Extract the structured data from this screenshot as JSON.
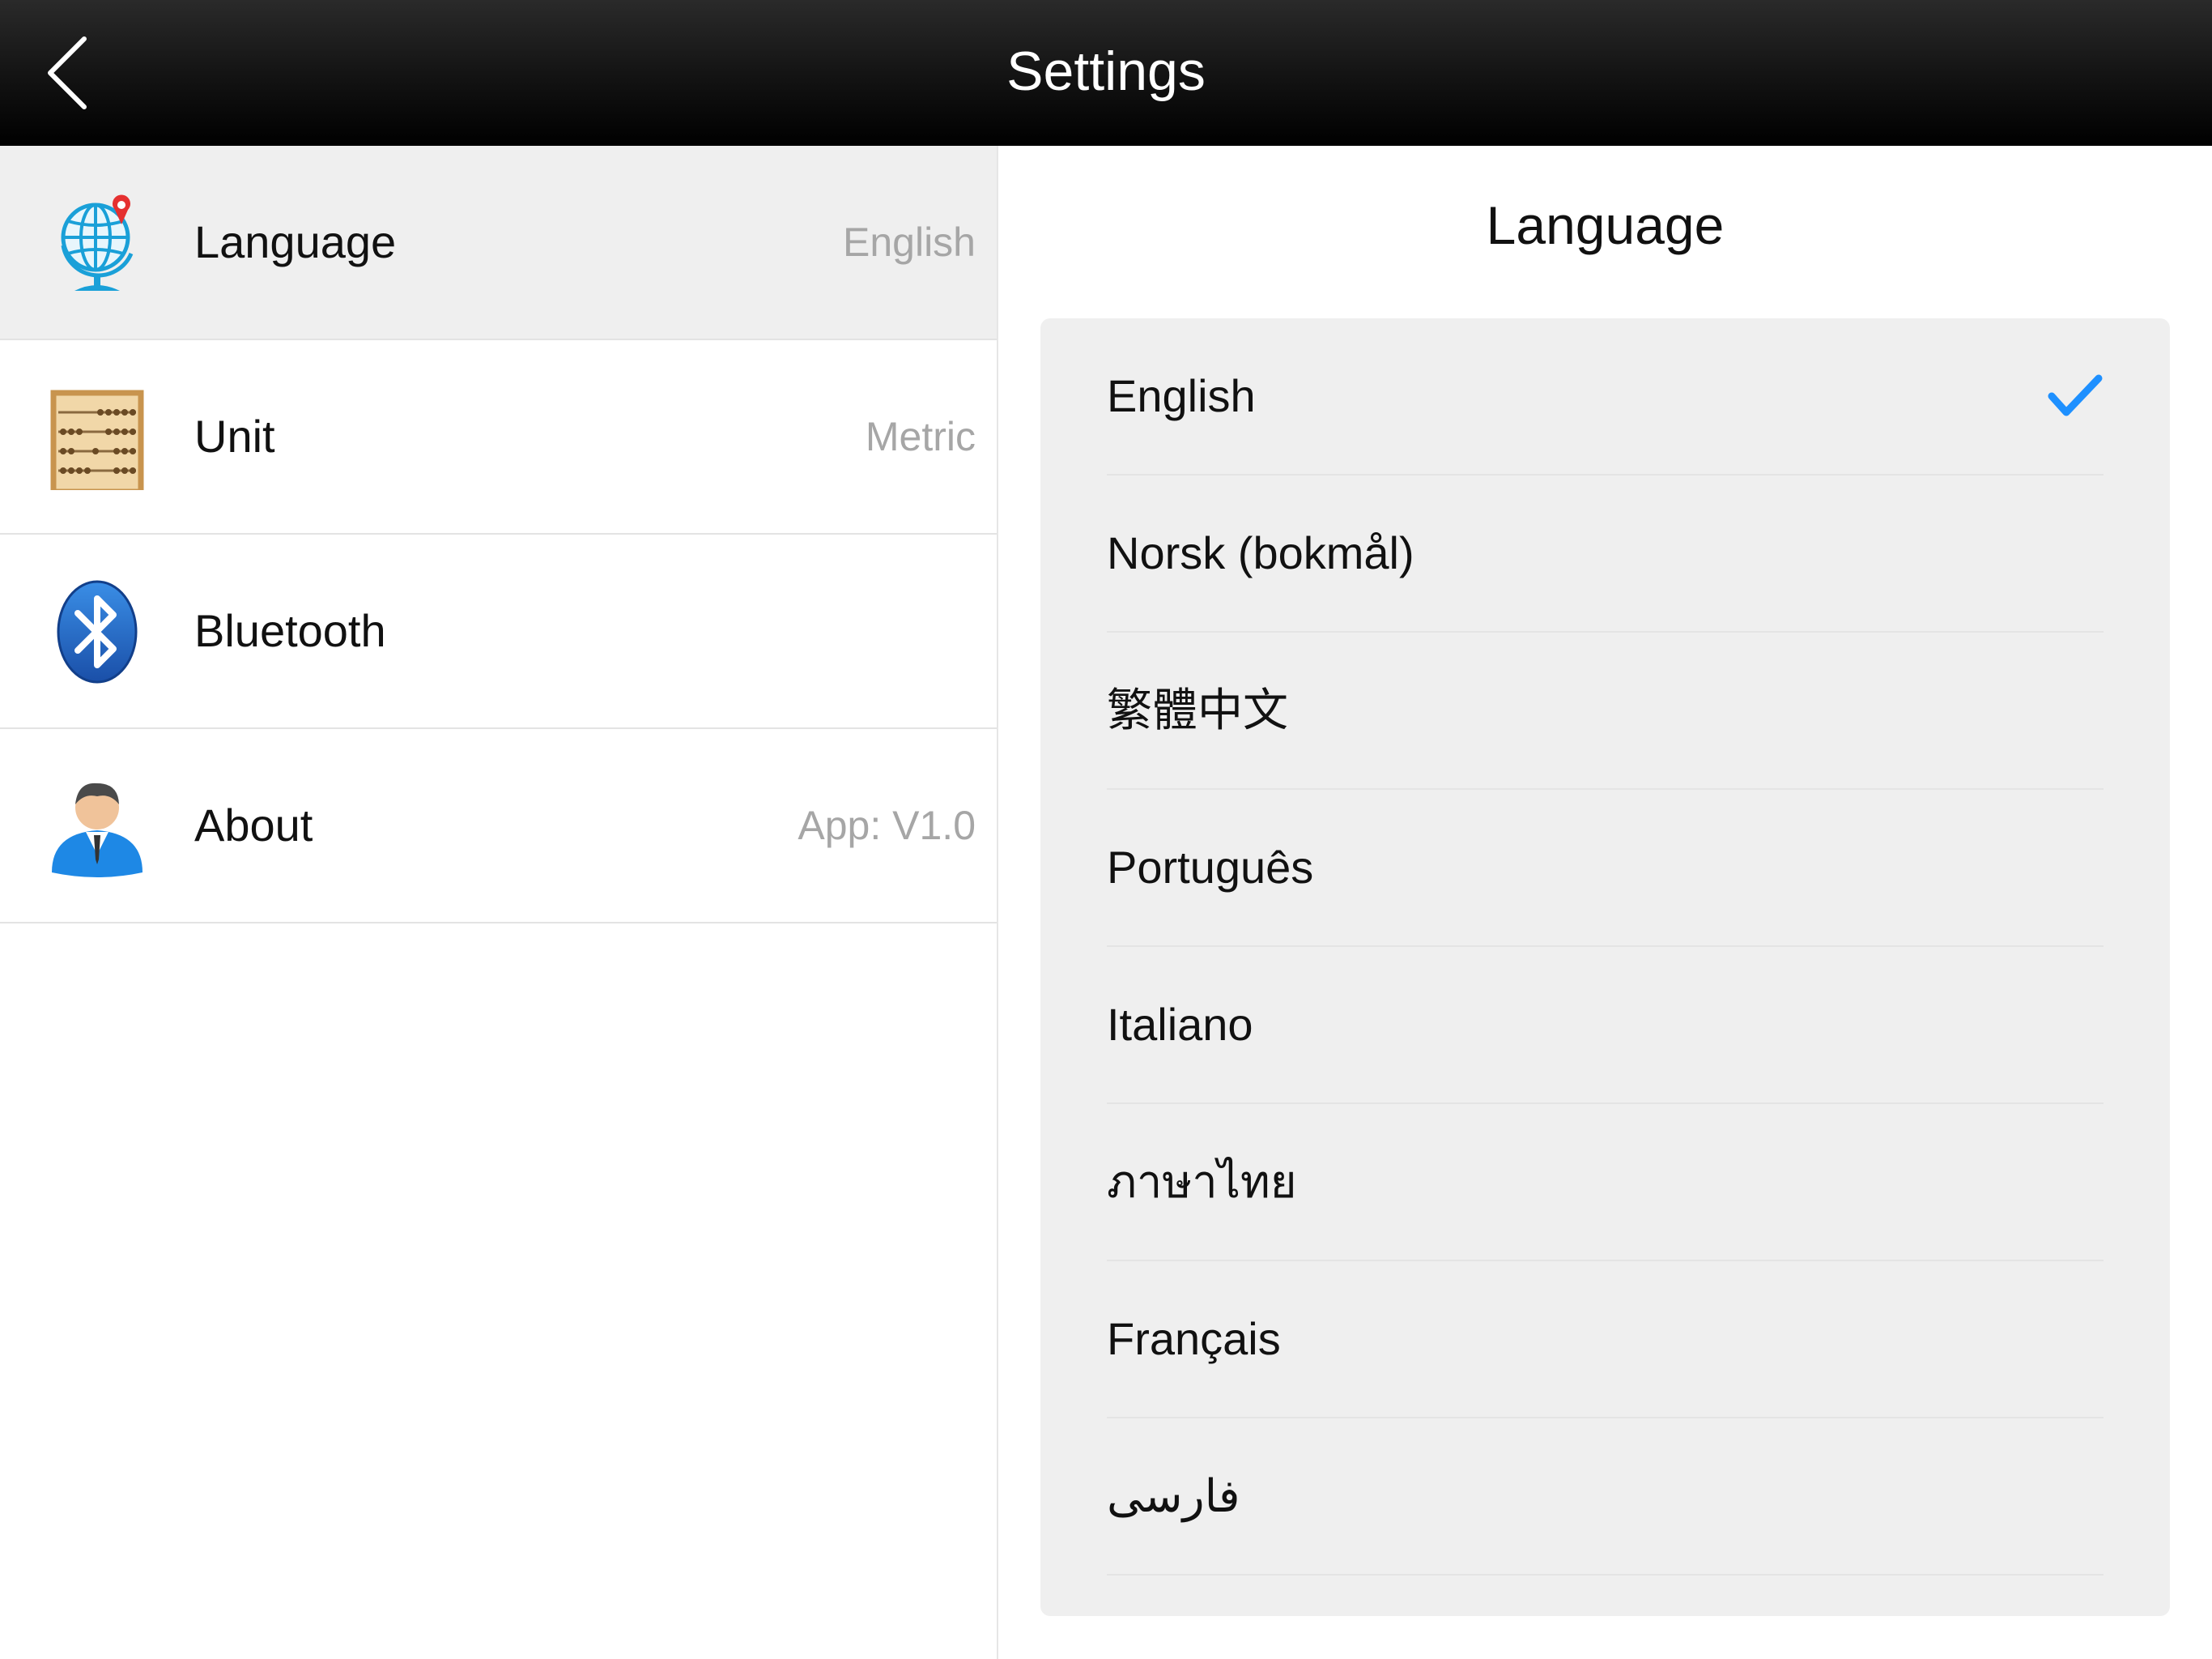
{
  "navbar": {
    "title": "Settings",
    "back_icon": "chevron-left-icon"
  },
  "settings": {
    "items": [
      {
        "label": "Language",
        "value": "English",
        "icon": "globe-icon",
        "selected": true
      },
      {
        "label": "Unit",
        "value": "Metric",
        "icon": "abacus-icon",
        "selected": false
      },
      {
        "label": "Bluetooth",
        "value": "",
        "icon": "bluetooth-icon",
        "selected": false
      },
      {
        "label": "About",
        "value": "App: V1.0",
        "icon": "user-icon",
        "selected": false
      }
    ]
  },
  "detail": {
    "title": "Language",
    "selected_language": "English",
    "languages": [
      "English",
      "Norsk (bokmål)",
      "繁體中文",
      "Português",
      "Italiano",
      "ภาษาไทย",
      "Français",
      "فارسی"
    ]
  },
  "colors": {
    "navbar_bg": "#000000",
    "selected_row_bg": "#efefef",
    "card_bg": "#efefef",
    "checkmark": "#1e90ff",
    "value_text": "#a6a6a6"
  }
}
